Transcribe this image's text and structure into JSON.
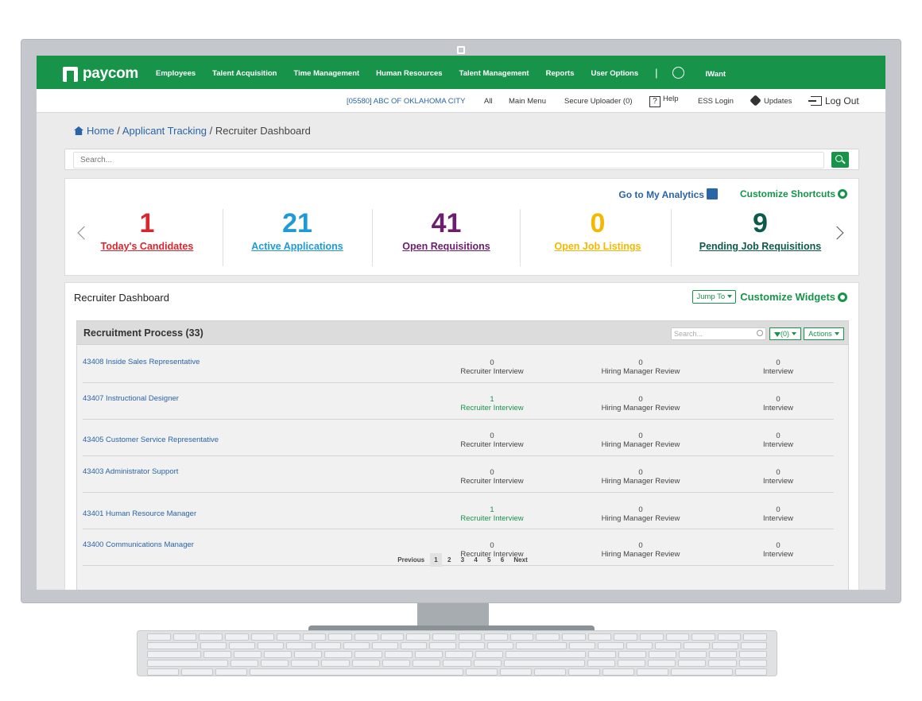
{
  "topbar": {
    "logo": "paycom",
    "nav": [
      "Employees",
      "Talent Acquisition",
      "Time Management",
      "Human Resources",
      "Talent Management",
      "Reports",
      "User Options"
    ],
    "separator": "|",
    "iwant": "IWant"
  },
  "subbar": {
    "company": "[05580] ABC OF OKLAHOMA CITY",
    "all": "All",
    "main_menu": "Main Menu",
    "uploader": "Secure Uploader (0)",
    "help_icon_text": "?",
    "help": "Help",
    "ess": "ESS Login",
    "updates": "Updates",
    "logout": "Log Out"
  },
  "breadcrumb": {
    "home": "Home",
    "sep1": " / ",
    "applicant_tracking": "Applicant Tracking",
    "sep2": " / ",
    "current": "Recruiter Dashboard"
  },
  "search": {
    "placeholder": "Search..."
  },
  "kpi": {
    "analytics_link": "Go to My Analytics",
    "shortcuts_link": "Customize Shortcuts",
    "items": [
      {
        "value": "1",
        "label": "Today's Candidates",
        "color": "#d7262e"
      },
      {
        "value": "21",
        "label": "Active Applications",
        "color": "#1e9ad6"
      },
      {
        "value": "41",
        "label": "Open Requisitions",
        "color": "#6b1e6e"
      },
      {
        "value": "0",
        "label": "Open Job Listings",
        "color": "#f5b800"
      },
      {
        "value": "9",
        "label": "Pending Job Requisitions",
        "color": "#0c5a4a"
      }
    ]
  },
  "dashboard": {
    "title": "Recruiter Dashboard",
    "jump_to": "Jump To",
    "customize_widgets": "Customize Widgets",
    "process": {
      "title": "Recruitment Process (33)",
      "search_placeholder": "Search...",
      "filter": "(0)",
      "actions": "Actions",
      "rows": [
        {
          "job": "43408 Inside Sales Representative",
          "s1": "0",
          "s1label": "Recruiter Interview",
          "s2": "0",
          "s2label": "Hiring Manager Review",
          "s3": "0",
          "s3label": "Interview"
        },
        {
          "job": "43407 Instructional Designer",
          "s1": "1",
          "s1label": "Recruiter Interview",
          "s2": "0",
          "s2label": "Hiring Manager Review",
          "s3": "0",
          "s3label": "Interview"
        },
        {
          "job": "43405 Customer Service Representative",
          "s1": "0",
          "s1label": "Recruiter Interview",
          "s2": "0",
          "s2label": "Hiring Manager Review",
          "s3": "0",
          "s3label": "Interview"
        },
        {
          "job": "43403 Administrator Support",
          "s1": "0",
          "s1label": "Recruiter Interview",
          "s2": "0",
          "s2label": "Hiring Manager Review",
          "s3": "0",
          "s3label": "Interview"
        },
        {
          "job": "43401 Human Resource Manager",
          "s1": "1",
          "s1label": "Recruiter Interview",
          "s2": "0",
          "s2label": "Hiring Manager Review",
          "s3": "0",
          "s3label": "Interview"
        },
        {
          "job": "43400 Communications Manager",
          "s1": "0",
          "s1label": "Recruiter Interview",
          "s2": "0",
          "s2label": "Hiring Manager Review",
          "s3": "0",
          "s3label": "Interview"
        }
      ],
      "pager": [
        "Previous",
        "1",
        "2",
        "3",
        "4",
        "5",
        "6",
        "Next"
      ]
    }
  }
}
